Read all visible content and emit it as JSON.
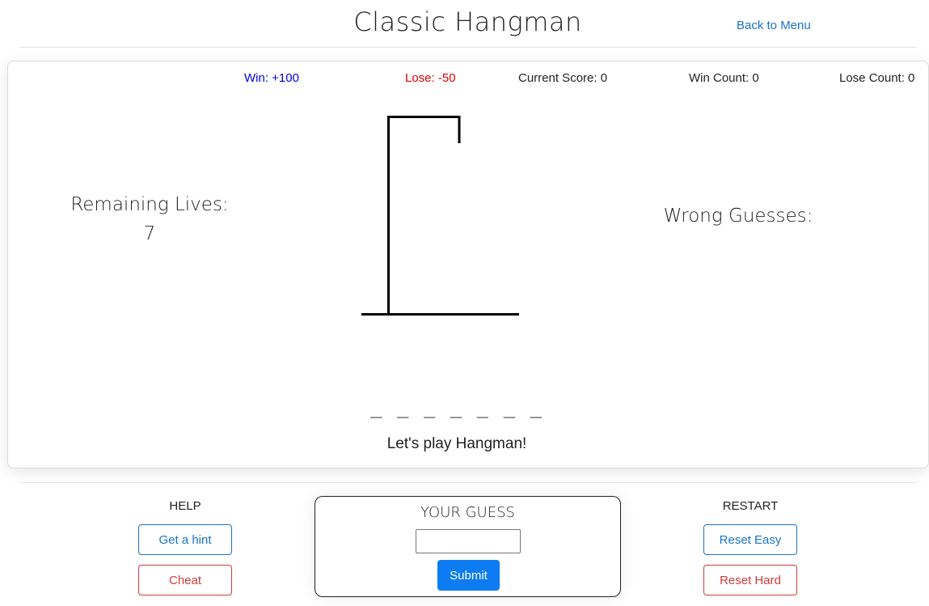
{
  "header": {
    "title": "Classic Hangman",
    "back_link": "Back to Menu"
  },
  "stats": {
    "win": "Win: +100",
    "lose": "Lose: -50",
    "current_score": "Current Score: 0",
    "win_count": "Win Count: 0",
    "lose_count": "Lose Count: 0"
  },
  "game": {
    "remaining_lives_label": "Remaining Lives:",
    "remaining_lives_value": "7",
    "wrong_guesses_label": "Wrong Guesses:",
    "word_blanks": "_ _ _ _ _ _ _",
    "message": "Let's play Hangman!"
  },
  "help": {
    "label": "HELP",
    "hint_button": "Get a hint",
    "cheat_button": "Cheat"
  },
  "guess": {
    "title": "YOUR GUESS",
    "input_value": "",
    "submit_button": "Submit"
  },
  "restart": {
    "label": "RESTART",
    "reset_easy_button": "Reset Easy",
    "reset_hard_button": "Reset Hard"
  },
  "colors": {
    "win": "#0000ee",
    "lose": "#e00000",
    "link": "#1a73c9",
    "danger": "#d33a3a",
    "primary": "#0d7cf2"
  }
}
